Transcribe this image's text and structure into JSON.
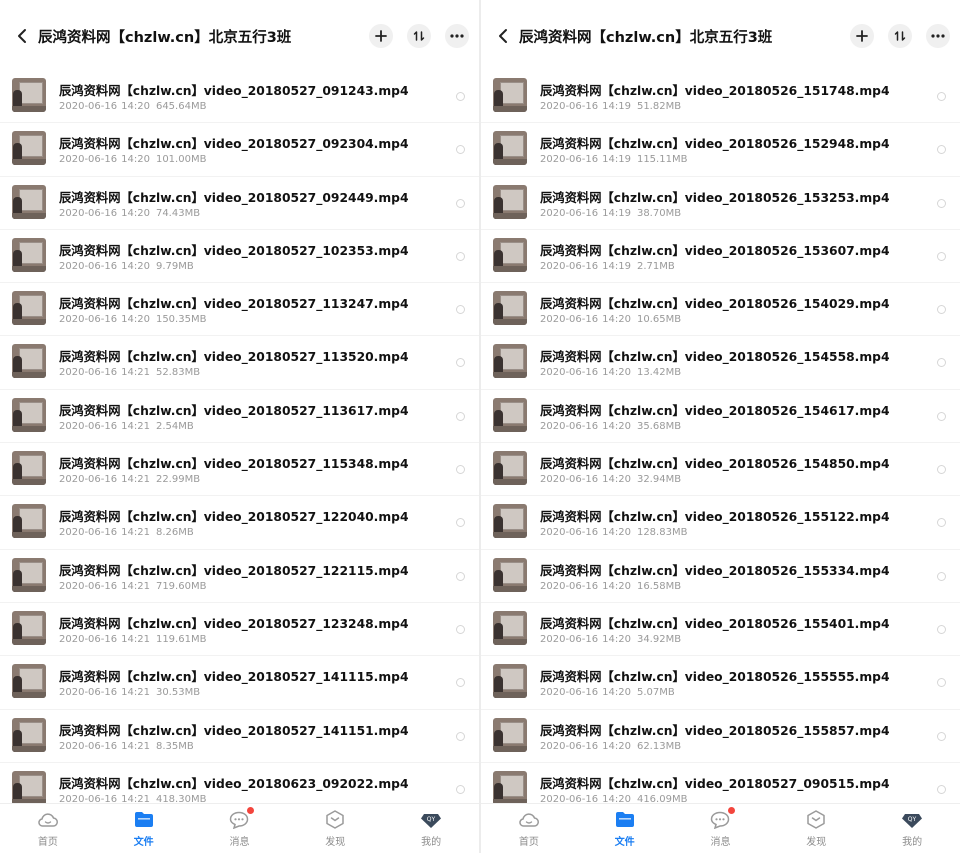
{
  "colors": {
    "accent": "#1b7ef2",
    "badge": "#f3453d",
    "meta": "#9a9a9a"
  },
  "tabbar": [
    {
      "label": "首页",
      "icon": "home-cloud-icon",
      "active": false
    },
    {
      "label": "文件",
      "icon": "folder-icon",
      "active": true
    },
    {
      "label": "消息",
      "icon": "chat-icon",
      "active": false,
      "badge": true
    },
    {
      "label": "发现",
      "icon": "discover-icon",
      "active": false
    },
    {
      "label": "我的",
      "icon": "profile-icon",
      "active": false
    }
  ],
  "screens": [
    {
      "title": "辰鸿资料网【chzlw.cn】北京五行3班",
      "files": [
        {
          "name": "辰鸿资料网【chzlw.cn】video_20180527_091243.mp4",
          "date": "2020-06-16",
          "time": "14:20",
          "size": "645.64MB"
        },
        {
          "name": "辰鸿资料网【chzlw.cn】video_20180527_092304.mp4",
          "date": "2020-06-16",
          "time": "14:20",
          "size": "101.00MB"
        },
        {
          "name": "辰鸿资料网【chzlw.cn】video_20180527_092449.mp4",
          "date": "2020-06-16",
          "time": "14:20",
          "size": "74.43MB"
        },
        {
          "name": "辰鸿资料网【chzlw.cn】video_20180527_102353.mp4",
          "date": "2020-06-16",
          "time": "14:20",
          "size": "9.79MB"
        },
        {
          "name": "辰鸿资料网【chzlw.cn】video_20180527_113247.mp4",
          "date": "2020-06-16",
          "time": "14:20",
          "size": "150.35MB"
        },
        {
          "name": "辰鸿资料网【chzlw.cn】video_20180527_113520.mp4",
          "date": "2020-06-16",
          "time": "14:21",
          "size": "52.83MB"
        },
        {
          "name": "辰鸿资料网【chzlw.cn】video_20180527_113617.mp4",
          "date": "2020-06-16",
          "time": "14:21",
          "size": "2.54MB"
        },
        {
          "name": "辰鸿资料网【chzlw.cn】video_20180527_115348.mp4",
          "date": "2020-06-16",
          "time": "14:21",
          "size": "22.99MB"
        },
        {
          "name": "辰鸿资料网【chzlw.cn】video_20180527_122040.mp4",
          "date": "2020-06-16",
          "time": "14:21",
          "size": "8.26MB"
        },
        {
          "name": "辰鸿资料网【chzlw.cn】video_20180527_122115.mp4",
          "date": "2020-06-16",
          "time": "14:21",
          "size": "719.60MB"
        },
        {
          "name": "辰鸿资料网【chzlw.cn】video_20180527_123248.mp4",
          "date": "2020-06-16",
          "time": "14:21",
          "size": "119.61MB"
        },
        {
          "name": "辰鸿资料网【chzlw.cn】video_20180527_141115.mp4",
          "date": "2020-06-16",
          "time": "14:21",
          "size": "30.53MB"
        },
        {
          "name": "辰鸿资料网【chzlw.cn】video_20180527_141151.mp4",
          "date": "2020-06-16",
          "time": "14:21",
          "size": "8.35MB"
        },
        {
          "name": "辰鸿资料网【chzlw.cn】video_20180623_092022.mp4",
          "date": "2020-06-16",
          "time": "14:21",
          "size": "418.30MB"
        }
      ]
    },
    {
      "title": "辰鸿资料网【chzlw.cn】北京五行3班",
      "files": [
        {
          "name": "辰鸿资料网【chzlw.cn】video_20180526_151748.mp4",
          "date": "2020-06-16",
          "time": "14:19",
          "size": "51.82MB"
        },
        {
          "name": "辰鸿资料网【chzlw.cn】video_20180526_152948.mp4",
          "date": "2020-06-16",
          "time": "14:19",
          "size": "115.11MB"
        },
        {
          "name": "辰鸿资料网【chzlw.cn】video_20180526_153253.mp4",
          "date": "2020-06-16",
          "time": "14:19",
          "size": "38.70MB"
        },
        {
          "name": "辰鸿资料网【chzlw.cn】video_20180526_153607.mp4",
          "date": "2020-06-16",
          "time": "14:19",
          "size": "2.71MB"
        },
        {
          "name": "辰鸿资料网【chzlw.cn】video_20180526_154029.mp4",
          "date": "2020-06-16",
          "time": "14:20",
          "size": "10.65MB"
        },
        {
          "name": "辰鸿资料网【chzlw.cn】video_20180526_154558.mp4",
          "date": "2020-06-16",
          "time": "14:20",
          "size": "13.42MB"
        },
        {
          "name": "辰鸿资料网【chzlw.cn】video_20180526_154617.mp4",
          "date": "2020-06-16",
          "time": "14:20",
          "size": "35.68MB"
        },
        {
          "name": "辰鸿资料网【chzlw.cn】video_20180526_154850.mp4",
          "date": "2020-06-16",
          "time": "14:20",
          "size": "32.94MB"
        },
        {
          "name": "辰鸿资料网【chzlw.cn】video_20180526_155122.mp4",
          "date": "2020-06-16",
          "time": "14:20",
          "size": "128.83MB"
        },
        {
          "name": "辰鸿资料网【chzlw.cn】video_20180526_155334.mp4",
          "date": "2020-06-16",
          "time": "14:20",
          "size": "16.58MB"
        },
        {
          "name": "辰鸿资料网【chzlw.cn】video_20180526_155401.mp4",
          "date": "2020-06-16",
          "time": "14:20",
          "size": "34.92MB"
        },
        {
          "name": "辰鸿资料网【chzlw.cn】video_20180526_155555.mp4",
          "date": "2020-06-16",
          "time": "14:20",
          "size": "5.07MB"
        },
        {
          "name": "辰鸿资料网【chzlw.cn】video_20180526_155857.mp4",
          "date": "2020-06-16",
          "time": "14:20",
          "size": "62.13MB"
        },
        {
          "name": "辰鸿资料网【chzlw.cn】video_20180527_090515.mp4",
          "date": "2020-06-16",
          "time": "14:20",
          "size": "416.09MB"
        }
      ]
    }
  ]
}
